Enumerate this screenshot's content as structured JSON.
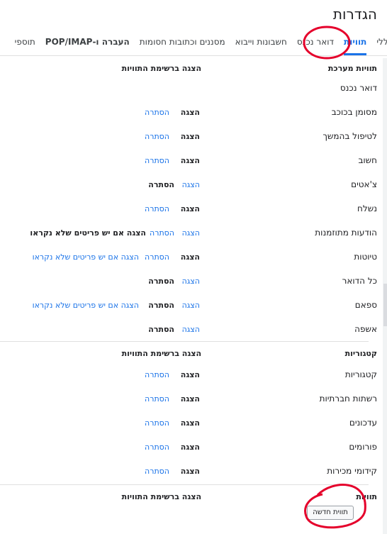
{
  "page_title": "הגדרות",
  "tabs": [
    {
      "label": "כללי"
    },
    {
      "label": "תוויות"
    },
    {
      "label": "דואר נכנס"
    },
    {
      "label": "חשבונות וייבוא"
    },
    {
      "label": "מסננים וכתובות חסומות"
    },
    {
      "label": "העברה ו-POP/IMAP"
    },
    {
      "label": "תוספי"
    }
  ],
  "system_labels": {
    "header": "תוויות מערכת",
    "column_header": "הצגה ברשימת התוויות",
    "rows": [
      {
        "label": "דואר נכנס"
      },
      {
        "label": "מסומן בכוכב",
        "show": "הצגה",
        "hide": "הסתרה"
      },
      {
        "label": "לטיפול בהמשך",
        "show": "הצגה",
        "hide": "הסתרה"
      },
      {
        "label": "חשוב",
        "show": "הצגה",
        "hide": "הסתרה"
      },
      {
        "label": "צ'אטים",
        "show": "הצגה",
        "hide": "הסתרה"
      },
      {
        "label": "נשלח",
        "show": "הצגה",
        "hide": "הסתרה"
      },
      {
        "label": "הודעות מתוזמנות",
        "show": "הצגה",
        "hide": "הסתרה",
        "unread": "הצגה אם יש פריטים שלא נקראו"
      },
      {
        "label": "טיוטות",
        "show": "הצגה",
        "hide": "הסתרה",
        "unread": "הצגה אם יש פריטים שלא נקראו"
      },
      {
        "label": "כל הדואר",
        "show": "הצגה",
        "hide": "הסתרה"
      },
      {
        "label": "ספאם",
        "show": "הצגה",
        "hide": "הסתרה",
        "unread": "הצגה אם יש פריטים שלא נקראו"
      },
      {
        "label": "אשפה",
        "show": "הצגה",
        "hide": "הסתרה"
      }
    ]
  },
  "categories": {
    "header": "קטגוריות",
    "column_header": "הצגה ברשימת התוויות",
    "rows": [
      {
        "label": "קטגוריות",
        "show": "הצגה",
        "hide": "הסתרה"
      },
      {
        "label": "רשתות חברתיות",
        "show": "הצגה",
        "hide": "הסתרה"
      },
      {
        "label": "עדכונים",
        "show": "הצגה",
        "hide": "הסתרה"
      },
      {
        "label": "פורומים",
        "show": "הצגה",
        "hide": "הסתרה"
      },
      {
        "label": "קידומי מכירות",
        "show": "הצגה",
        "hide": "הסתרה"
      }
    ]
  },
  "labels": {
    "header": "תוויות",
    "column_header": "הצגה ברשימת התוויות",
    "new_label_button": "תווית חדשה"
  },
  "colors": {
    "link": "#1a73e8",
    "annotation": "#e5002b"
  }
}
